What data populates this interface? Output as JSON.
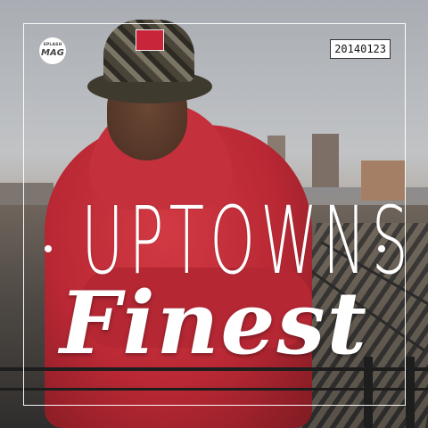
{
  "cover": {
    "publisher_logo": {
      "line1": "SPLASH",
      "line2": "MAG"
    },
    "date_badge": "20140123",
    "title_top": "UPTOWNS",
    "title_script": "Finest"
  },
  "colors": {
    "hoodie_red": "#c4303b",
    "text_white": "#ffffff",
    "sky_gray": "#b9bcc0"
  }
}
